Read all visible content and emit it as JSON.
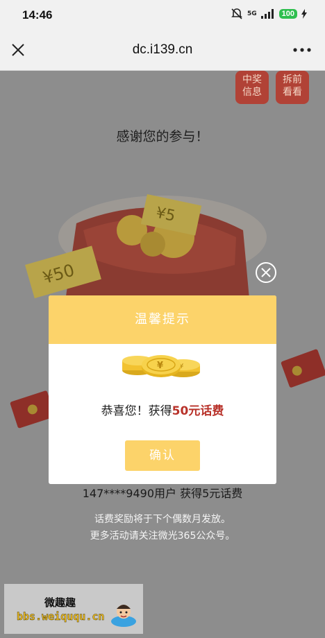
{
  "status_bar": {
    "time": "14:46",
    "network": "5G",
    "battery": "100"
  },
  "nav": {
    "title": "dc.i139.cn",
    "close_icon": "close-icon",
    "more_icon": "more-icon"
  },
  "page": {
    "side_tabs": [
      {
        "line1": "中奖",
        "line2": "信息"
      },
      {
        "line1": "拆前",
        "line2": "看看"
      }
    ],
    "thanks": "感谢您的参与！",
    "coupons": [
      "¥5",
      "¥50"
    ],
    "winner_text": "147****9490用户   获得5元话费",
    "info_line1": "话费奖励将于下个偶数月发放。",
    "info_line2": "更多活动请关注微光365公众号。"
  },
  "dialog": {
    "title": "温馨提示",
    "message_prefix": "恭喜您！获得",
    "prize": "50元话费",
    "confirm": "确认"
  },
  "watermark": {
    "cn": "微趣趣",
    "url": "bbs.weiququ.cn"
  },
  "colors": {
    "dialog_header": "#fcd36a",
    "prize_text": "#b8322a",
    "side_tab": "#b14236"
  }
}
